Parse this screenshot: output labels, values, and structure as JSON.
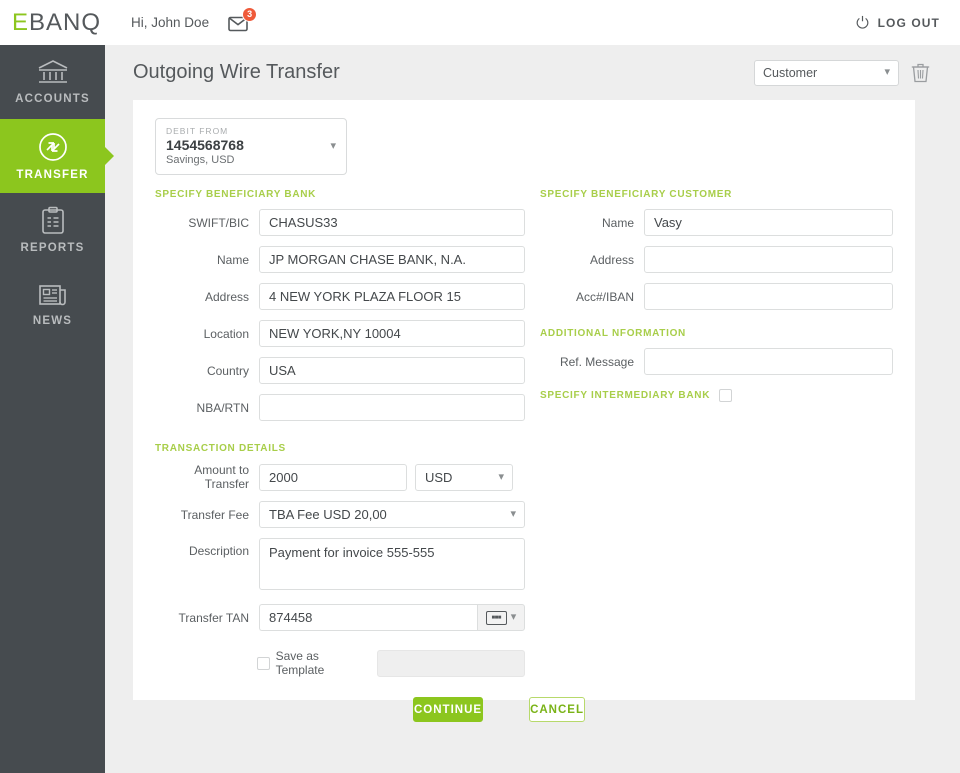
{
  "brand": {
    "logo_first": "E",
    "logo_rest": "BANQ"
  },
  "topbar": {
    "greeting": "Hi, John Doe",
    "mail_badge": "3",
    "logout_label": "LOG OUT"
  },
  "sidebar": {
    "items": [
      {
        "label": "ACCOUNTS",
        "icon": "bank-icon",
        "active": false
      },
      {
        "label": "TRANSFER",
        "icon": "transfer-icon",
        "active": true
      },
      {
        "label": "REPORTS",
        "icon": "clipboard-icon",
        "active": false
      },
      {
        "label": "NEWS",
        "icon": "newspaper-icon",
        "active": false
      }
    ]
  },
  "page": {
    "title": "Outgoing Wire Transfer",
    "customer_select": "Customer"
  },
  "debit_from": {
    "label": "DEBIT FROM",
    "account_number": "1454568768",
    "account_type": "Savings, USD"
  },
  "beneficiary_bank": {
    "heading": "SPECIFY BENEFICIARY BANK",
    "fields": [
      {
        "label": "SWIFT/BIC",
        "value": "CHASUS33"
      },
      {
        "label": "Name",
        "value": "JP MORGAN CHASE BANK, N.A."
      },
      {
        "label": "Address",
        "value": "4 NEW YORK PLAZA FLOOR 15"
      },
      {
        "label": "Location",
        "value": "NEW YORK,NY 10004"
      },
      {
        "label": "Country",
        "value": "USA"
      },
      {
        "label": "NBA/RTN",
        "value": ""
      }
    ]
  },
  "beneficiary_customer": {
    "heading": "SPECIFY BENEFICIARY CUSTOMER",
    "fields": [
      {
        "label": "Name",
        "value": "Vasy"
      },
      {
        "label": "Address",
        "value": ""
      },
      {
        "label": "Acc#/IBAN",
        "value": ""
      }
    ]
  },
  "additional_information": {
    "heading": "ADDITIONAL NFORMATION",
    "ref_message_label": "Ref. Message",
    "ref_message_value": ""
  },
  "intermediary": {
    "label": "SPECIFY INTERMEDIARY BANK",
    "checked": false
  },
  "transaction_details": {
    "heading": "TRANSACTION DETAILS",
    "amount_label": "Amount to Transfer",
    "amount_value": "2000",
    "currency_value": "USD",
    "fee_label": "Transfer Fee",
    "fee_value": "TBA Fee USD 20,00",
    "description_label": "Description",
    "description_value": "Payment for invoice 555-555",
    "tan_label": "Transfer TAN",
    "tan_value": "874458"
  },
  "footer": {
    "save_template_label": "Save as Template",
    "template_name_value": "",
    "continue_label": "CONTINUE",
    "cancel_label": "CANCEL"
  },
  "colors": {
    "accent_green": "#8cc61e",
    "section_green": "#a8ce4a",
    "sidebar_dark": "#464b4f",
    "badge_red": "#ef5a3a",
    "page_bg": "#eeeeee"
  }
}
